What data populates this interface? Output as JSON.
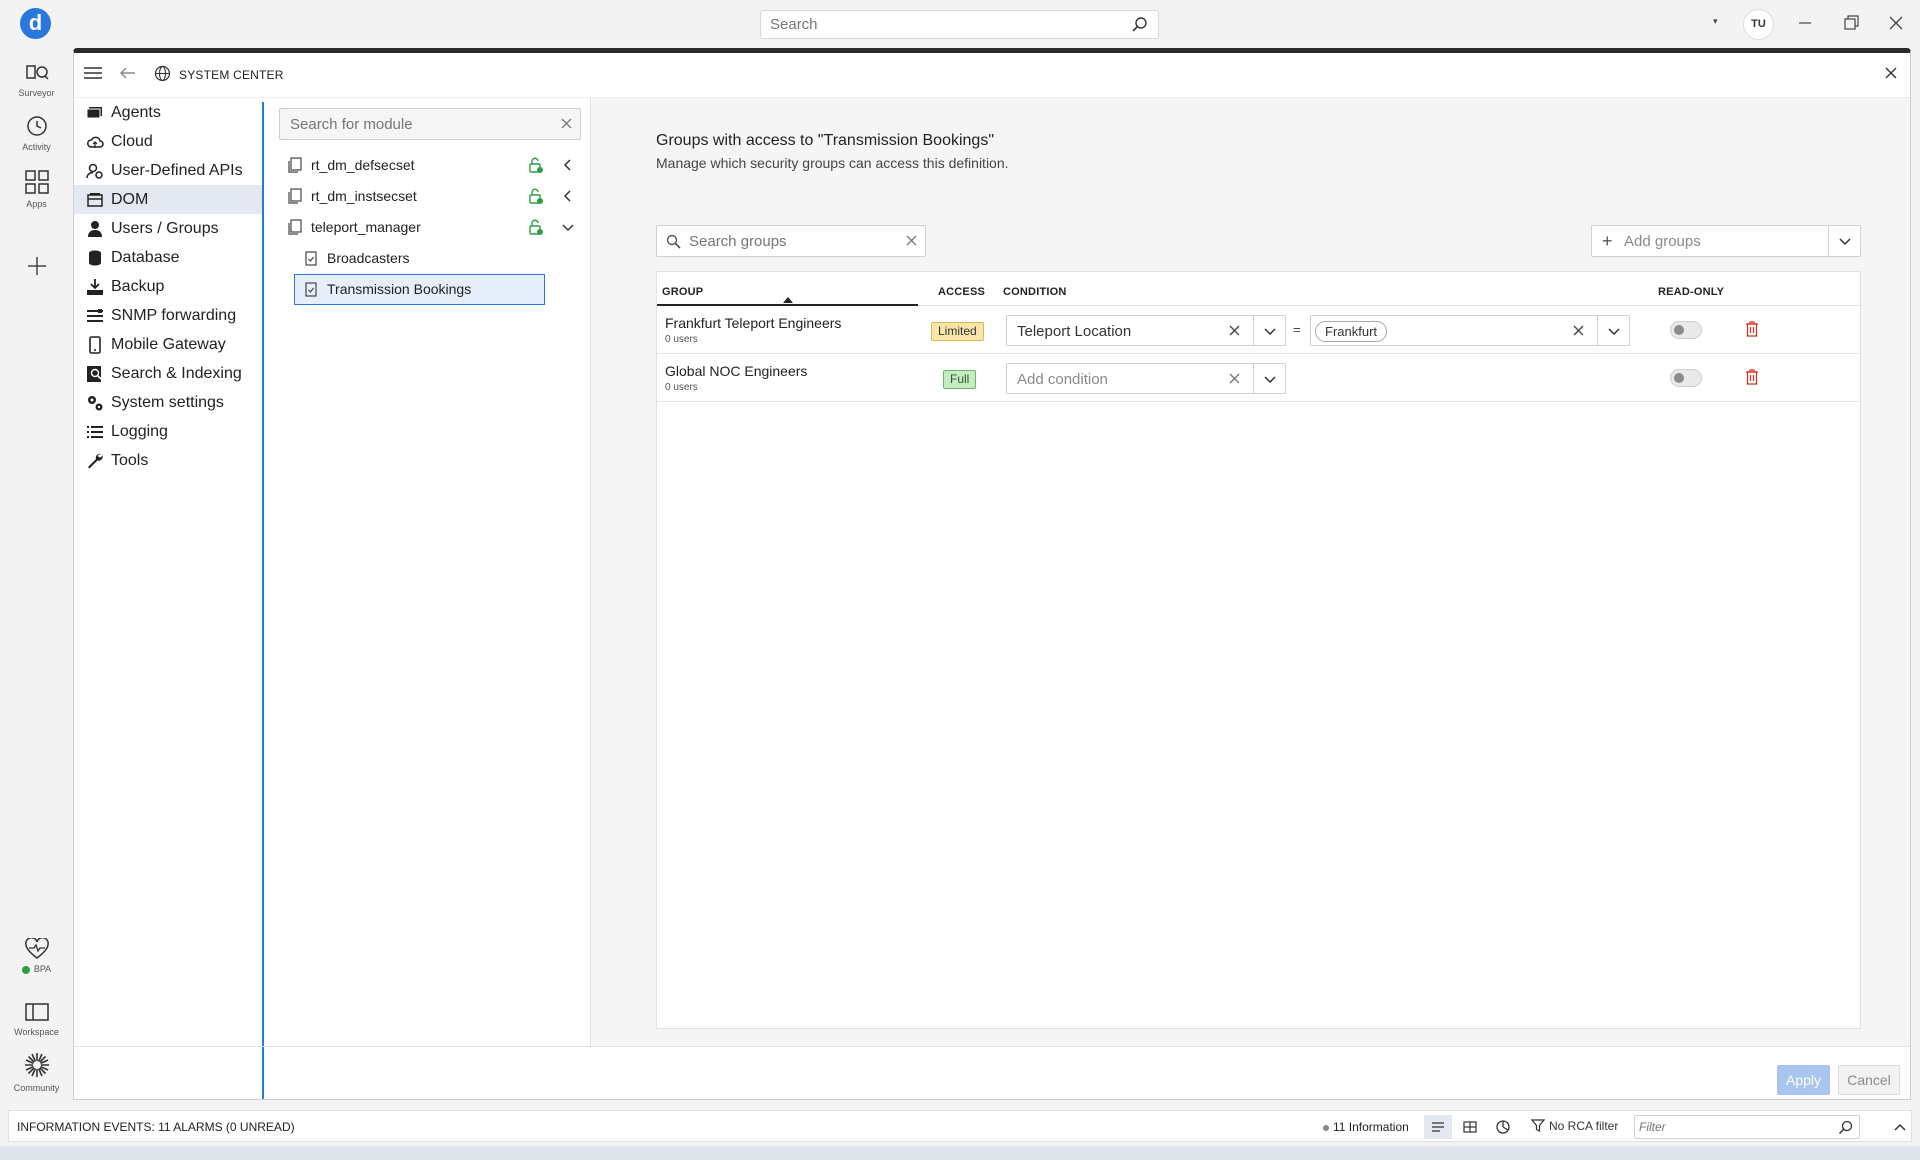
{
  "app": {
    "logo_letter": "d",
    "user_initials": "TU"
  },
  "topbar": {
    "search_placeholder": "Search"
  },
  "rail": {
    "top": [
      {
        "label": "Surveyor",
        "icon": "surveyor-icon"
      },
      {
        "label": "Activity",
        "icon": "activity-icon"
      },
      {
        "label": "Apps",
        "icon": "apps-icon"
      }
    ],
    "bottom": [
      {
        "label": "BPA",
        "icon": "heartbeat-icon",
        "status_color": "#2ea043"
      },
      {
        "label": "Workspace",
        "icon": "workspace-icon"
      },
      {
        "label": "Community",
        "icon": "community-icon"
      }
    ]
  },
  "window": {
    "title": "SYSTEM CENTER"
  },
  "nav": {
    "items": [
      {
        "label": "Agents",
        "icon": "agents-icon"
      },
      {
        "label": "Cloud",
        "icon": "cloud-icon"
      },
      {
        "label": "User-Defined APIs",
        "icon": "api-icon"
      },
      {
        "label": "DOM",
        "icon": "dom-icon",
        "active": true
      },
      {
        "label": "Users / Groups",
        "icon": "user-icon"
      },
      {
        "label": "Database",
        "icon": "database-icon"
      },
      {
        "label": "Backup",
        "icon": "backup-icon"
      },
      {
        "label": "SNMP forwarding",
        "icon": "snmp-icon"
      },
      {
        "label": "Mobile Gateway",
        "icon": "mobile-icon"
      },
      {
        "label": "Search & Indexing",
        "icon": "search-indexing-icon"
      },
      {
        "label": "System settings",
        "icon": "settings-icon"
      },
      {
        "label": "Logging",
        "icon": "logging-icon"
      },
      {
        "label": "Tools",
        "icon": "tools-icon"
      }
    ]
  },
  "modules": {
    "search_placeholder": "Search for module",
    "items": [
      {
        "label": "rt_dm_defsecset",
        "expanded": false
      },
      {
        "label": "rt_dm_instsecset",
        "expanded": false
      },
      {
        "label": "teleport_manager",
        "expanded": true
      }
    ],
    "children": [
      {
        "label": "Broadcasters",
        "selected": false
      },
      {
        "label": "Transmission Bookings",
        "selected": true
      }
    ]
  },
  "content": {
    "title": "Groups with access to \"Transmission Bookings\"",
    "subtitle": "Manage which security groups can access this definition.",
    "search_placeholder": "Search groups",
    "add_groups_label": "Add groups",
    "columns": {
      "group": "GROUP",
      "access": "ACCESS",
      "condition": "CONDITION",
      "readonly": "READ-ONLY"
    },
    "rows": [
      {
        "name": "Frankfurt Teleport Engineers",
        "users": "0 users",
        "access": "Limited",
        "condition": "Teleport Location",
        "operator": "=",
        "value": "Frankfurt",
        "readonly": false
      },
      {
        "name": "Global NOC Engineers",
        "users": "0 users",
        "access": "Full",
        "condition_placeholder": "Add condition",
        "readonly": false
      }
    ],
    "apply_label": "Apply",
    "cancel_label": "Cancel"
  },
  "statusbar": {
    "text": "INFORMATION EVENTS: 11 ALARMS (0 UNREAD)",
    "info_count": "11 Information",
    "rca_filter": "No RCA filter",
    "filter_placeholder": "Filter"
  }
}
